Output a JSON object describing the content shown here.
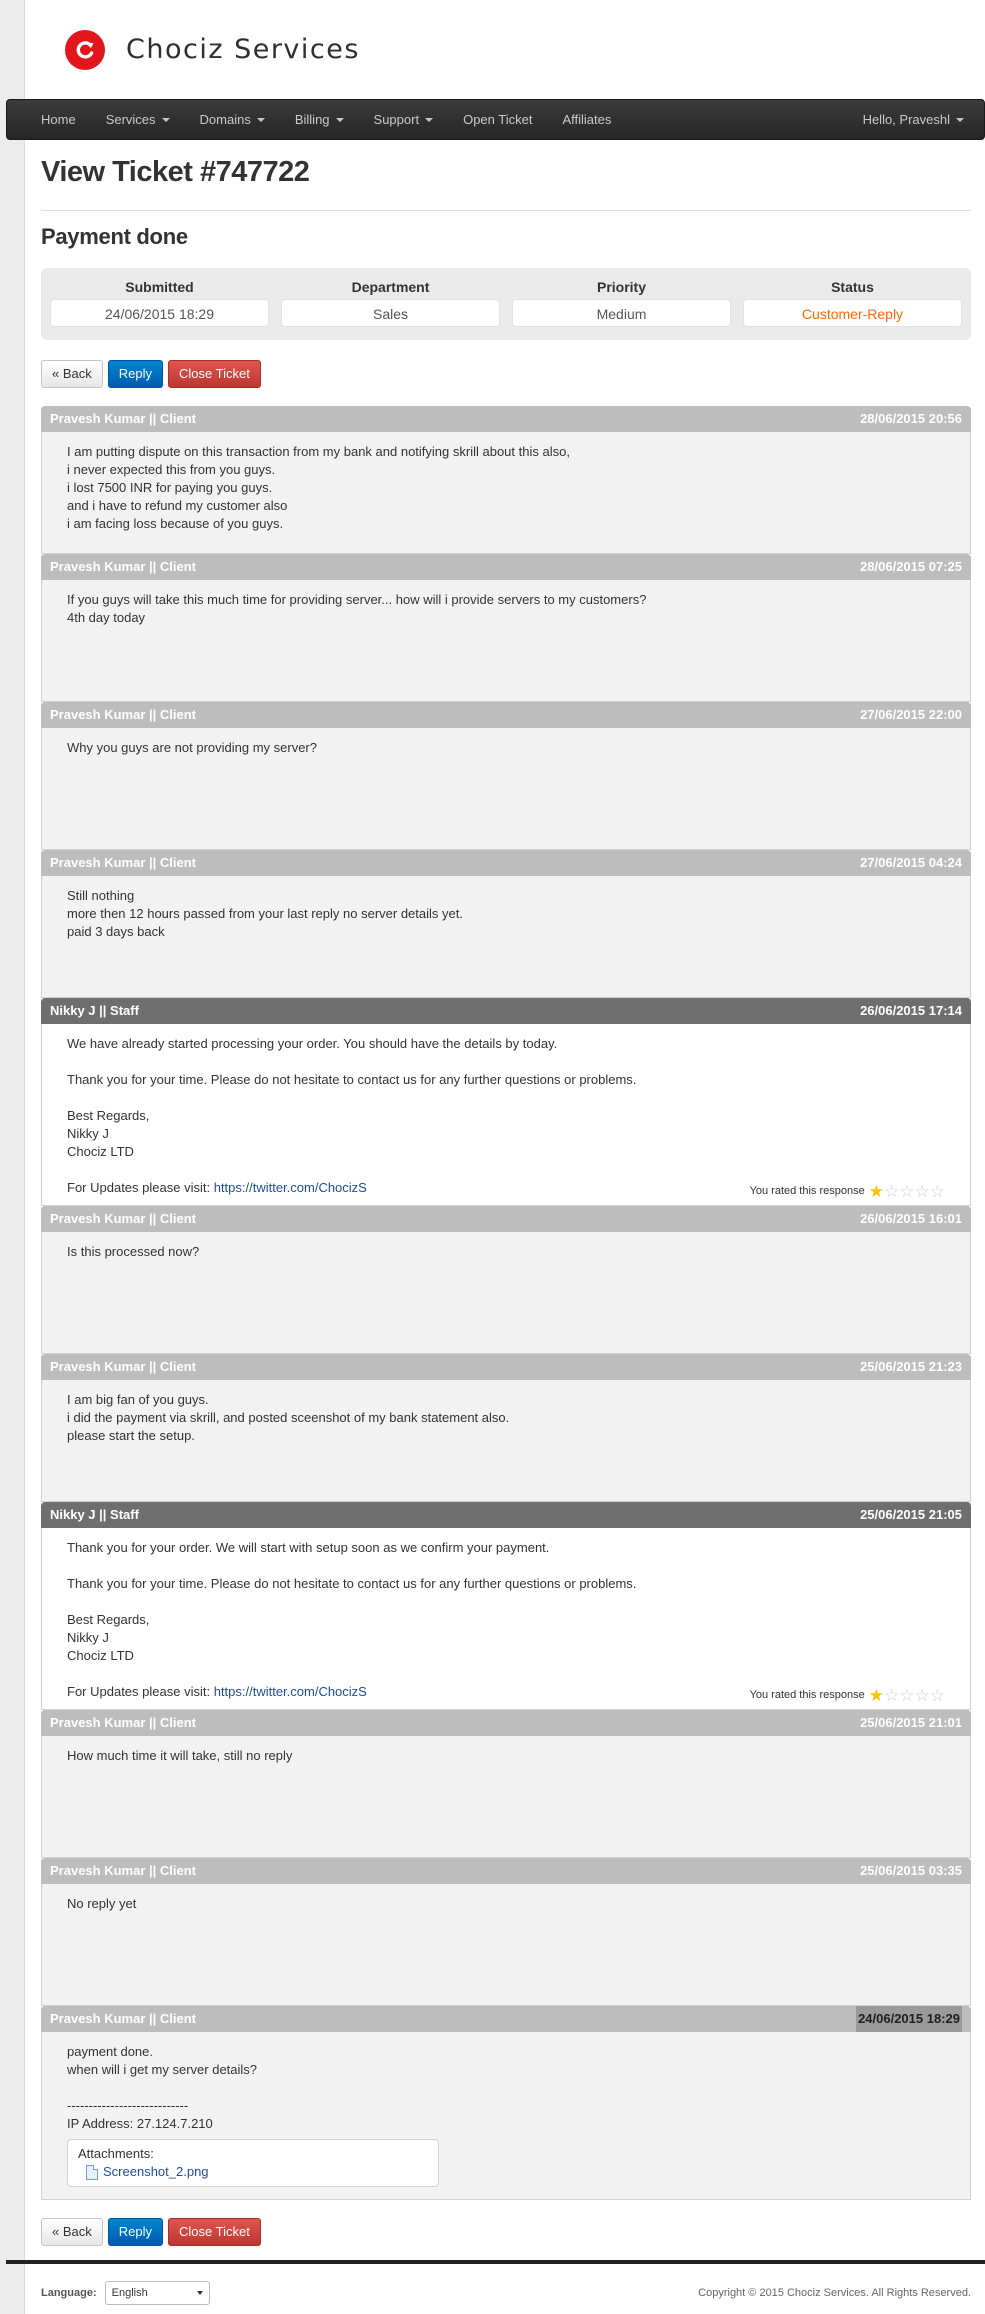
{
  "brand": {
    "name": "Chociz Services",
    "accent": "#e3161c"
  },
  "nav": {
    "items": [
      {
        "label": "Home",
        "dropdown": false
      },
      {
        "label": "Services",
        "dropdown": true
      },
      {
        "label": "Domains",
        "dropdown": true
      },
      {
        "label": "Billing",
        "dropdown": true
      },
      {
        "label": "Support",
        "dropdown": true
      },
      {
        "label": "Open Ticket",
        "dropdown": false
      },
      {
        "label": "Affiliates",
        "dropdown": false
      }
    ],
    "user_label": "Hello, Praveshl"
  },
  "ticket": {
    "title": "View Ticket #747722",
    "subject": "Payment done",
    "info": {
      "submitted_label": "Submitted",
      "submitted_value": "24/06/2015 18:29",
      "department_label": "Department",
      "department_value": "Sales",
      "priority_label": "Priority",
      "priority_value": "Medium",
      "status_label": "Status",
      "status_value": "Customer-Reply",
      "status_color": "#ff6600"
    }
  },
  "buttons": {
    "back": "« Back",
    "reply": "Reply",
    "close": "Close Ticket"
  },
  "messages": [
    {
      "author": "Pravesh Kumar || Client",
      "role": "client",
      "date": "28/06/2015 20:56",
      "min_height": 122,
      "lines": [
        "I am putting dispute on this transaction from my bank and notifying skrill about this also,",
        "i never expected this from you guys.",
        "i lost 7500 INR for paying you guys.",
        "and i have to refund my customer also",
        "i am facing loss because of you guys."
      ]
    },
    {
      "author": "Pravesh Kumar || Client",
      "role": "client",
      "date": "28/06/2015 07:25",
      "min_height": 122,
      "lines": [
        "If you guys will take this much time for providing server... how will i provide servers to my customers?",
        "4th day today"
      ]
    },
    {
      "author": "Pravesh Kumar || Client",
      "role": "client",
      "date": "27/06/2015 22:00",
      "min_height": 122,
      "lines": [
        "Why you guys are not providing my server?"
      ]
    },
    {
      "author": "Pravesh Kumar || Client",
      "role": "client",
      "date": "27/06/2015 04:24",
      "min_height": 122,
      "lines": [
        "Still nothing",
        "more then 12 hours passed from your last reply no server details yet.",
        "paid 3 days back"
      ]
    },
    {
      "author": "Nikky J || Staff",
      "role": "staff",
      "date": "26/06/2015 17:14",
      "min_height": 0,
      "lines": [
        "We have already started processing your order. You should have the details by today.",
        "",
        "Thank you for your time. Please do not hesitate to contact us for any further questions or problems.",
        "",
        "Best Regards,",
        "Nikky J",
        "Chociz LTD",
        ""
      ],
      "updates_prefix": "For Updates please visit: ",
      "updates_link": "https://twitter.com/ChocizS",
      "rating_text": "You rated this response",
      "rating": 1
    },
    {
      "author": "Pravesh Kumar || Client",
      "role": "client",
      "date": "26/06/2015 16:01",
      "min_height": 122,
      "lines": [
        "Is this processed now?"
      ]
    },
    {
      "author": "Pravesh Kumar || Client",
      "role": "client",
      "date": "25/06/2015 21:23",
      "min_height": 122,
      "lines": [
        "I am big fan of you guys.",
        "i did the payment via skrill, and posted sceenshot of my bank statement also.",
        "please start the setup."
      ]
    },
    {
      "author": "Nikky J || Staff",
      "role": "staff",
      "date": "25/06/2015 21:05",
      "min_height": 0,
      "lines": [
        "Thank you for your order. We will start with setup soon as we confirm your payment.",
        "",
        "Thank you for your time. Please do not hesitate to contact us for any further questions or problems.",
        "",
        "Best Regards,",
        "Nikky J",
        "Chociz LTD",
        ""
      ],
      "updates_prefix": "For Updates please visit: ",
      "updates_link": "https://twitter.com/ChocizS",
      "rating_text": "You rated this response",
      "rating": 1
    },
    {
      "author": "Pravesh Kumar || Client",
      "role": "client",
      "date": "25/06/2015 21:01",
      "min_height": 122,
      "lines": [
        "How much time it will take, still no reply"
      ]
    },
    {
      "author": "Pravesh Kumar || Client",
      "role": "client",
      "date": "25/06/2015 03:35",
      "min_height": 122,
      "lines": [
        "No reply yet"
      ]
    },
    {
      "author": "Pravesh Kumar || Client",
      "role": "client",
      "date": "24/06/2015 18:29",
      "min_height": 0,
      "date_highlight": true,
      "lines": [
        "payment done.",
        "when will i get my server details?",
        "",
        "----------------------------",
        "IP Address: 27.124.7.210"
      ],
      "attachments_label": "Attachments:",
      "attachment": "Screenshot_2.png"
    }
  ],
  "footer": {
    "language_label": "Language:",
    "language_value": "English",
    "copyright": "Copyright © 2015 Chociz Services. All Rights Reserved."
  }
}
